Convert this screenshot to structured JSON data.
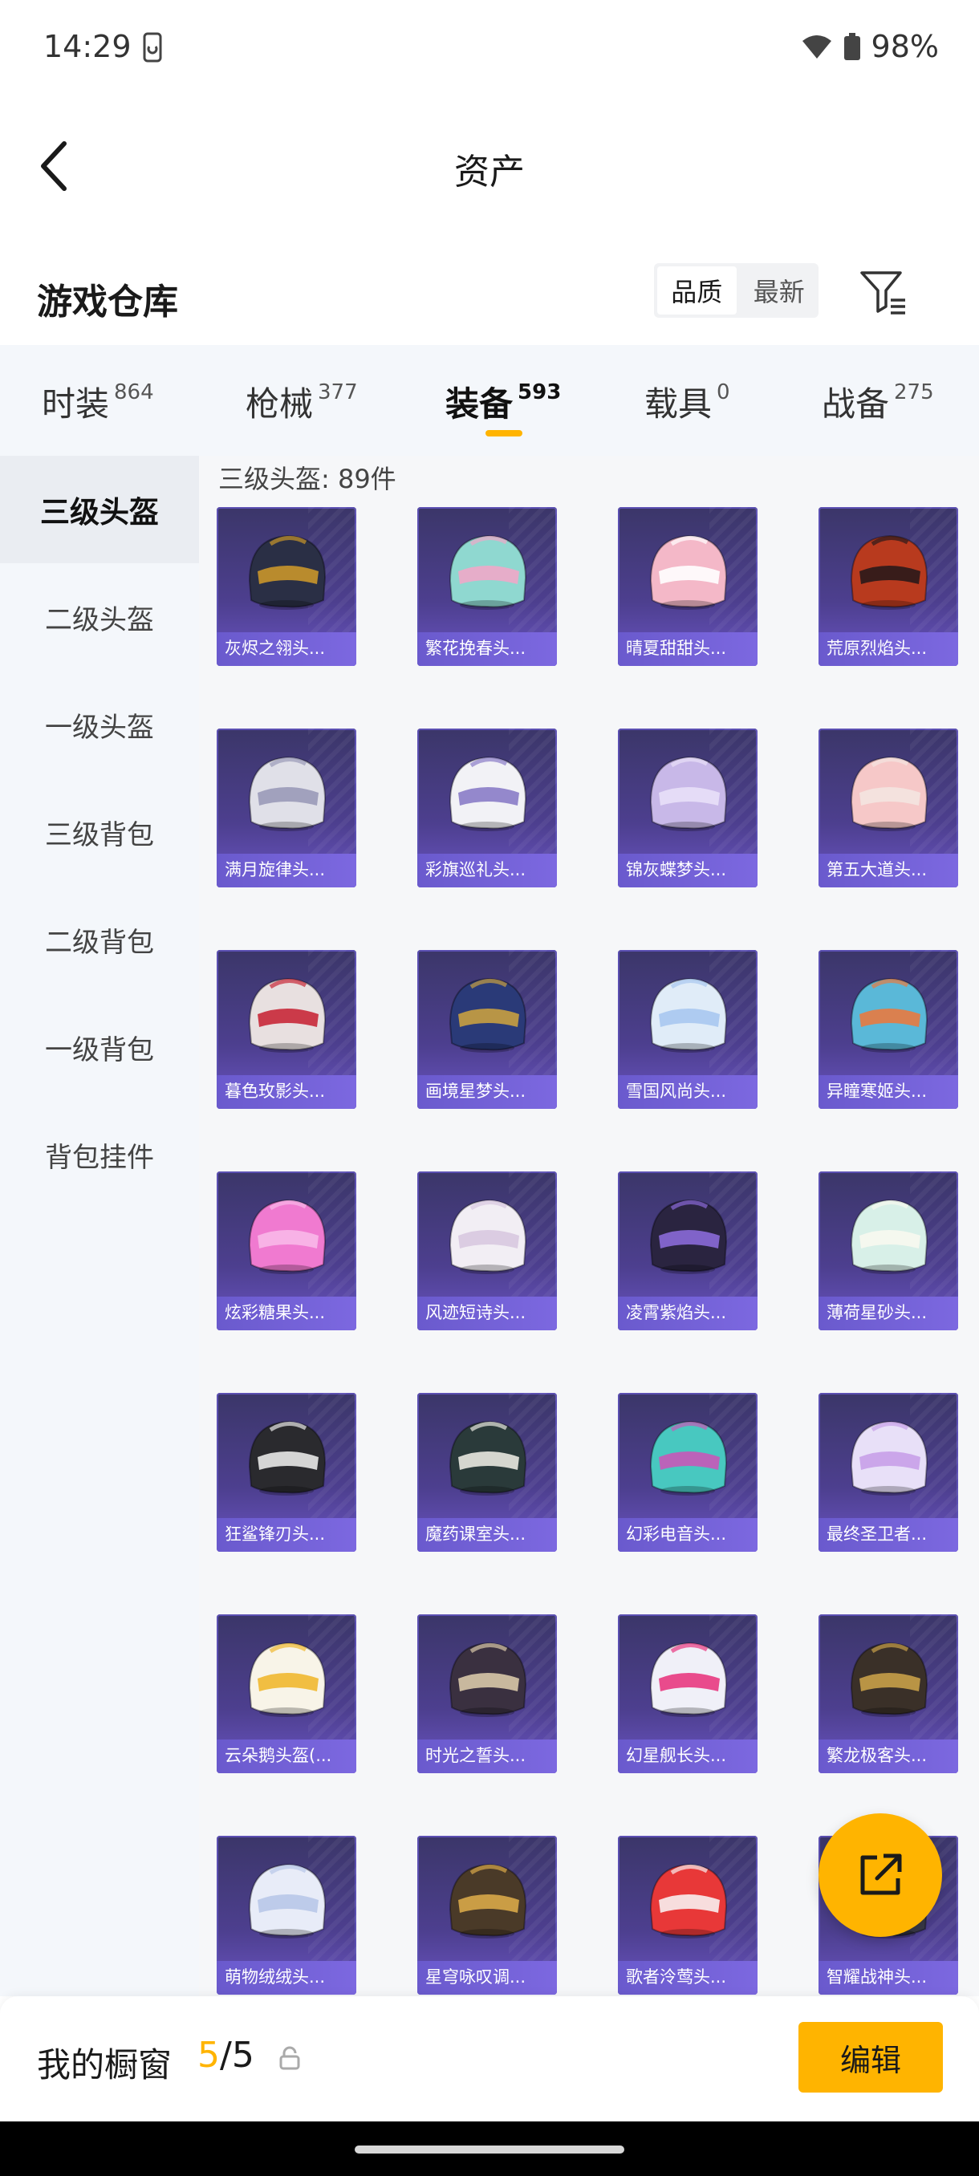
{
  "status": {
    "time": "14:29",
    "battery": "98%"
  },
  "header": {
    "title": "资产"
  },
  "section": {
    "title": "游戏仓库",
    "sort_options": [
      "品质",
      "最新"
    ]
  },
  "tabs": [
    {
      "label": "时装",
      "count": "864"
    },
    {
      "label": "枪械",
      "count": "377"
    },
    {
      "label": "装备",
      "count": "593"
    },
    {
      "label": "载具",
      "count": "0"
    },
    {
      "label": "战备",
      "count": "275"
    }
  ],
  "sidebar": {
    "items": [
      "三级头盔",
      "二级头盔",
      "一级头盔",
      "三级背包",
      "二级背包",
      "一级背包",
      "背包挂件"
    ]
  },
  "content": {
    "count_label": "三级头盔: 89件",
    "items": [
      {
        "name": "灰烬之翎头...",
        "c1": "#2a2f45",
        "c2": "#c9962a"
      },
      {
        "name": "繁花挽春头...",
        "c1": "#8fd8d0",
        "c2": "#f0a8c8"
      },
      {
        "name": "晴夏甜甜头...",
        "c1": "#f4b8c8",
        "c2": "#ffffff"
      },
      {
        "name": "荒原烈焰头...",
        "c1": "#b83a1e",
        "c2": "#2a1a1a"
      },
      {
        "name": "满月旋律头...",
        "c1": "#e0e0e8",
        "c2": "#9a9ab8"
      },
      {
        "name": "彩旗巡礼头...",
        "c1": "#f2f2f6",
        "c2": "#8a7cc8"
      },
      {
        "name": "锦灰蝶梦头...",
        "c1": "#c8b8e8",
        "c2": "#e8e0f8"
      },
      {
        "name": "第五大道头...",
        "c1": "#f6c8c8",
        "c2": "#f4e4e0"
      },
      {
        "name": "暮色玫影头...",
        "c1": "#e8e0e0",
        "c2": "#c82838"
      },
      {
        "name": "画境星梦头...",
        "c1": "#2a3a78",
        "c2": "#c8a040"
      },
      {
        "name": "雪国风尚头...",
        "c1": "#e0ecf8",
        "c2": "#a8c8f0"
      },
      {
        "name": "异瞳寒姬头...",
        "c1": "#5ab8d8",
        "c2": "#e87a40"
      },
      {
        "name": "炫彩糖果头...",
        "c1": "#f07ad0",
        "c2": "#f8b8e8"
      },
      {
        "name": "风迹短诗头...",
        "c1": "#f2eef4",
        "c2": "#d8c8e0"
      },
      {
        "name": "凌霄紫焰头...",
        "c1": "#2a2440",
        "c2": "#8a6ad8"
      },
      {
        "name": "薄荷星砂头...",
        "c1": "#d8f0e8",
        "c2": "#f8f8f0"
      },
      {
        "name": "狂鲨锋刃头...",
        "c1": "#2a2a2e",
        "c2": "#e8e8e8"
      },
      {
        "name": "魔药课室头...",
        "c1": "#2a3a3a",
        "c2": "#e8e8e0"
      },
      {
        "name": "幻彩电音头...",
        "c1": "#48c8c0",
        "c2": "#c858b8"
      },
      {
        "name": "最终圣卫者...",
        "c1": "#e8e0f8",
        "c2": "#c8a0e8"
      },
      {
        "name": "云朵鹅头盔(...",
        "c1": "#f8f4e8",
        "c2": "#f0b830"
      },
      {
        "name": "时光之誓头...",
        "c1": "#3a3040",
        "c2": "#d8c8a8"
      },
      {
        "name": "幻星舰长头...",
        "c1": "#f0f0f8",
        "c2": "#e83880"
      },
      {
        "name": "繁龙极客头...",
        "c1": "#3a3028",
        "c2": "#c8a048"
      },
      {
        "name": "萌物绒绒头...",
        "c1": "#e8ecf8",
        "c2": "#b8c8e8"
      },
      {
        "name": "星穹咏叹调...",
        "c1": "#4a3a28",
        "c2": "#d8a848"
      },
      {
        "name": "歌者泠莺头...",
        "c1": "#e83838",
        "c2": "#f8f0f0"
      },
      {
        "name": "智耀战神头...",
        "c1": "#3a3a48",
        "c2": "#d8b040"
      }
    ]
  },
  "bottom": {
    "showcase_label": "我的橱窗",
    "current": "5",
    "separator": "/",
    "total": "5",
    "edit_label": "编辑"
  },
  "colors": {
    "accent": "#ffb400",
    "card_bg": "#4d3f8f"
  },
  "icons": [
    "phone-icon",
    "wifi-icon",
    "battery-icon",
    "back-arrow-icon",
    "filter-icon",
    "share-icon",
    "lock-icon"
  ]
}
